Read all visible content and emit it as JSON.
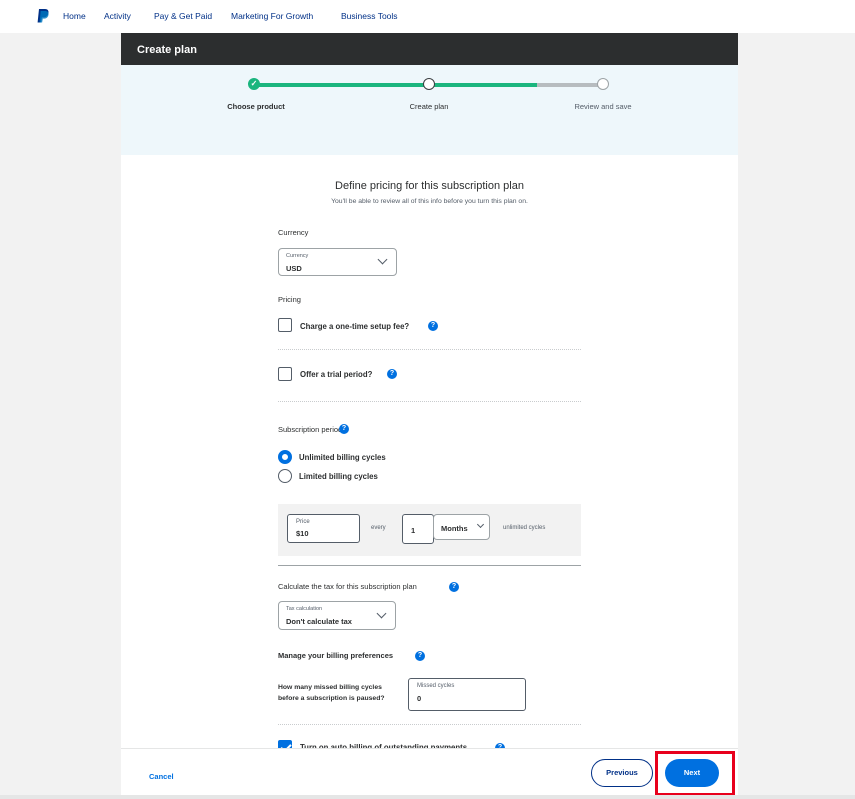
{
  "nav": {
    "items": [
      "Home",
      "Activity",
      "Pay & Get Paid",
      "Marketing For Growth",
      "Business Tools"
    ]
  },
  "header": {
    "title": "Create plan"
  },
  "stepper": {
    "steps": [
      {
        "label": "Choose product",
        "state": "done"
      },
      {
        "label": "Create plan",
        "state": "current"
      },
      {
        "label": "Review and save",
        "state": "todo"
      }
    ]
  },
  "form": {
    "title": "Define pricing for this subscription plan",
    "subtitle": "You'll be able to review all of this info before you turn this plan on.",
    "currency": {
      "section_label": "Currency",
      "field_label": "Currency",
      "value": "USD"
    },
    "pricing": {
      "section_label": "Pricing",
      "setup_fee_label": "Charge a one-time setup fee?",
      "setup_fee_checked": false,
      "trial_label": "Offer a trial period?",
      "trial_checked": false
    },
    "subscription_period": {
      "section_label": "Subscription period",
      "options": [
        "Unlimited billing cycles",
        "Limited billing cycles"
      ],
      "selected": "Unlimited billing cycles",
      "price_label": "Price",
      "price_value": "$10",
      "every_label": "every",
      "interval_value": "1",
      "interval_unit": "Months",
      "cycles_text": "unlimited cycles"
    },
    "tax": {
      "section_label": "Calculate the tax for this subscription plan",
      "field_label": "Tax calculation",
      "value": "Don't calculate tax"
    },
    "billing_prefs": {
      "section_label": "Manage your billing preferences",
      "question_line1": "How many missed billing cycles",
      "question_line2": "before a subscription is paused?",
      "field_label": "Missed cycles",
      "value": "0",
      "auto_billing_label": "Turn on auto billing of outstanding payments",
      "auto_billing_checked": true
    }
  },
  "footer": {
    "cancel_label": "Cancel",
    "previous_label": "Previous",
    "next_label": "Next"
  },
  "colors": {
    "brand_blue": "#0070e0",
    "navy": "#003087",
    "success_green": "#1bb57e",
    "header_dark": "#2c2e2f",
    "highlight_red": "#e8001c"
  }
}
